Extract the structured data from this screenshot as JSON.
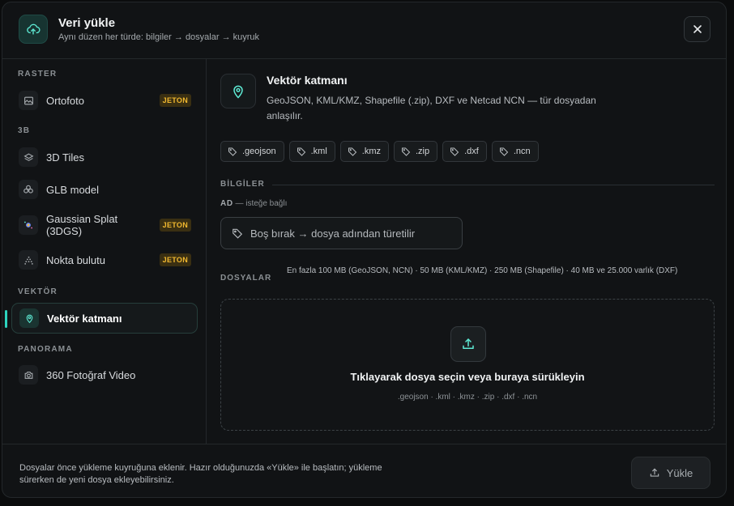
{
  "header": {
    "title": "Veri yükle",
    "subtitle": "Aynı düzen her türde: bilgiler → dosyalar → kuyruk",
    "icon": "cloud-upload-icon",
    "close_icon": "close-icon"
  },
  "sidebar": {
    "groups": [
      {
        "label": "RASTER"
      },
      {
        "label": "3B"
      },
      {
        "label": "VEKTÖR"
      },
      {
        "label": "PANORAMA"
      }
    ],
    "items": [
      {
        "label": "Ortofoto",
        "icon": "image-icon",
        "badge": "JETON"
      },
      {
        "label": "3D Tiles",
        "icon": "layers-icon",
        "badge": ""
      },
      {
        "label": "GLB model",
        "icon": "cubes-icon",
        "badge": ""
      },
      {
        "label": "Gaussian Splat (3DGS)",
        "icon": "splat-icon",
        "badge": "JETON"
      },
      {
        "label": "Nokta bulutu",
        "icon": "point-cloud-icon",
        "badge": "JETON"
      },
      {
        "label": "Vektör katmanı",
        "icon": "map-pin-icon",
        "badge": "",
        "active": true
      },
      {
        "label": "360 Fotoğraf Video",
        "icon": "camera-icon",
        "badge": ""
      }
    ]
  },
  "main": {
    "title": "Vektör katmanı",
    "description": "GeoJSON, KML/KMZ, Shapefile (.zip), DXF ve Netcad NCN — tür dosyadan anlaşılır.",
    "extensions": [
      ".geojson",
      ".kml",
      ".kmz",
      ".zip",
      ".dxf",
      ".ncn"
    ],
    "info_heading": "BİLGİLER",
    "name_label": "AD",
    "name_optional": "— isteğe bağlı",
    "name_placeholder": "Boş bırak → dosya adından türetilir",
    "files_heading": "DOSYALAR",
    "files_limit": "En fazla 100 MB (GeoJSON, NCN) · 50 MB (KML/KMZ) · 250 MB (Shapefile) · 40 MB ve 25.000 varlık (DXF)",
    "dropzone_text": "Tıklayarak dosya seçin veya buraya sürükleyin",
    "dropzone_exts": ".geojson · .kml · .kmz · .zip · .dxf · .ncn"
  },
  "footer": {
    "note": "Dosyalar önce yükleme kuyruğuna eklenir. Hazır olduğunuzda «Yükle» ile başlatın; yükleme sürerken de yeni dosya ekleyebilirsiniz.",
    "upload_label": "Yükle"
  },
  "colors": {
    "accent": "#2dd4bf",
    "badge_text": "#f2b92f",
    "badge_bg": "#3a2f12"
  }
}
